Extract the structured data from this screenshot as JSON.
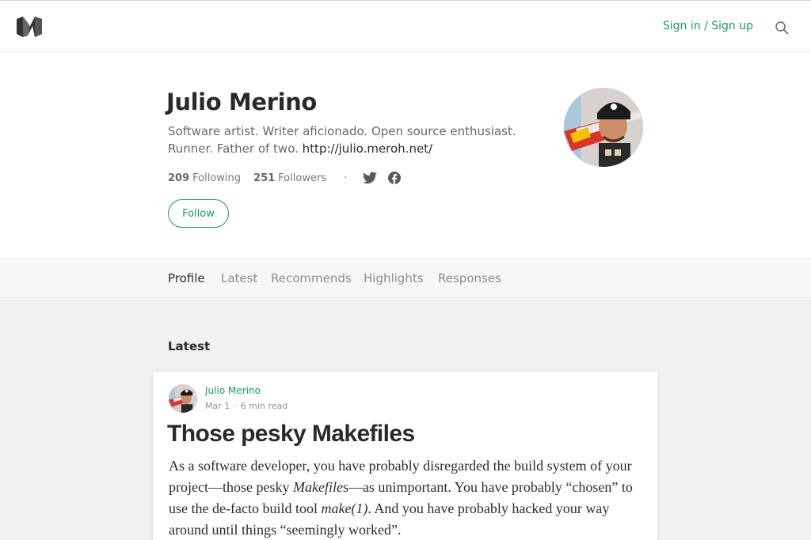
{
  "header": {
    "logo_icon": "medium-logo-icon",
    "signin_label": "Sign in / Sign up",
    "search_icon": "search-icon",
    "accent_color": "#1c9963"
  },
  "profile": {
    "name": "Julio Merino",
    "bio_text": "Software artist. Writer aficionado. Open source enthusiast. Runner. Father of two.",
    "bio_link": "http://julio.meroh.net/",
    "following_count": "209",
    "following_label": "Following",
    "followers_count": "251",
    "followers_label": "Followers",
    "separator": "·",
    "social_icons": [
      "twitter-icon",
      "facebook-icon"
    ],
    "follow_label": "Follow"
  },
  "tabs": [
    {
      "label": "Profile",
      "active": true
    },
    {
      "label": "Latest",
      "active": false
    },
    {
      "label": "Recommends",
      "active": false
    },
    {
      "label": "Highlights",
      "active": false
    },
    {
      "label": "Responses",
      "active": false
    }
  ],
  "latest": {
    "heading": "Latest",
    "post": {
      "author": "Julio Merino",
      "date": "Mar 1",
      "separator": "·",
      "read_time": "6 min read",
      "title": "Those pesky Makefiles",
      "excerpt": {
        "p1": "As a software developer, you have probably disregarded the build system of your project—those pesky ",
        "em1": "Makefile",
        "p2": "s—as unimportant. You have probably “chosen” to use the de-facto build tool ",
        "em2": "make(1)",
        "p3": ". And you have probably hacked your way around until things “seemingly worked”."
      }
    }
  }
}
